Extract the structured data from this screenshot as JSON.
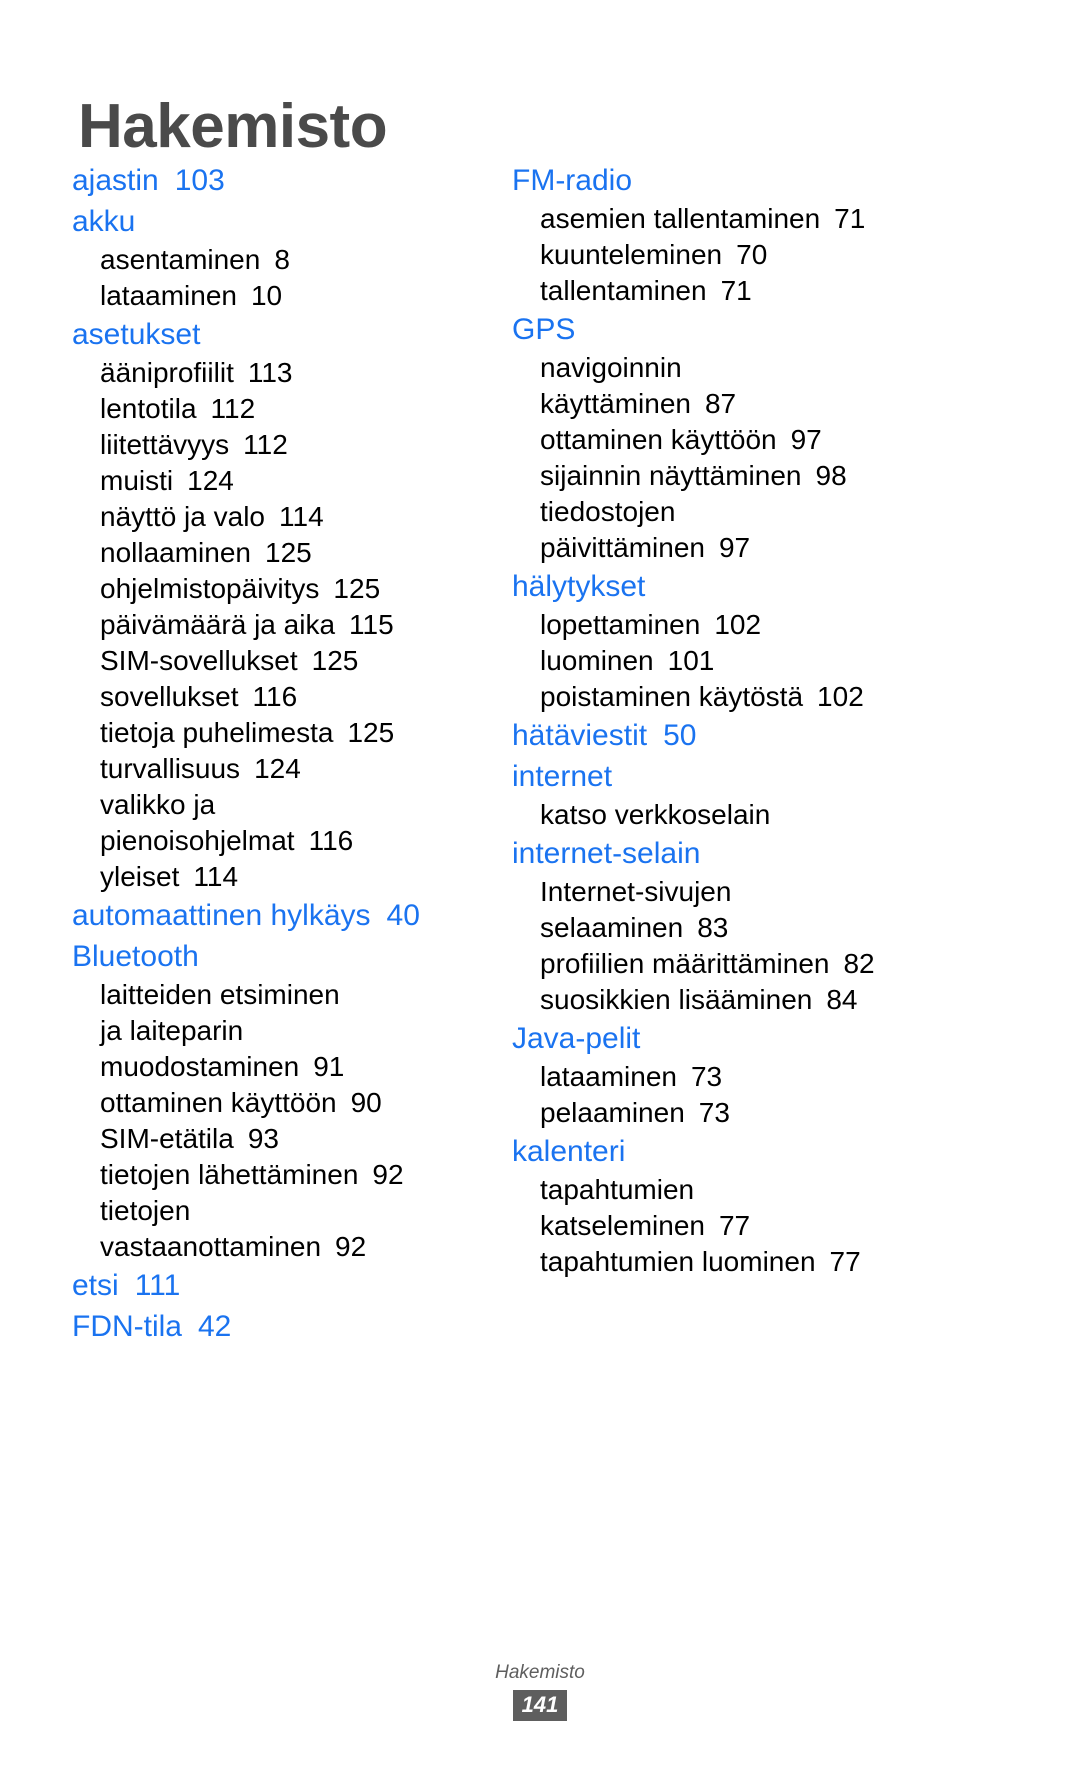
{
  "page": {
    "title": "Hakemisto",
    "footer_label": "Hakemisto",
    "footer_page": "141",
    "accent_color": "#1a73f0",
    "title_color": "#4a4a4a",
    "footer_color": "#5e5e5e"
  },
  "columns": [
    {
      "name": "left-column",
      "entries": [
        {
          "type": "term",
          "label": "ajastin",
          "page": "103"
        },
        {
          "type": "term",
          "label": "akku",
          "page": ""
        },
        {
          "type": "sub",
          "label": "asentaminen",
          "page": "8"
        },
        {
          "type": "sub",
          "label": "lataaminen",
          "page": "10"
        },
        {
          "type": "term",
          "label": "asetukset",
          "page": ""
        },
        {
          "type": "sub",
          "label": "ääniprofiilit",
          "page": "113"
        },
        {
          "type": "sub",
          "label": "lentotila",
          "page": "112"
        },
        {
          "type": "sub",
          "label": "liitettävyys",
          "page": "112"
        },
        {
          "type": "sub",
          "label": "muisti",
          "page": "124"
        },
        {
          "type": "sub",
          "label": "näyttö ja valo",
          "page": "114"
        },
        {
          "type": "sub",
          "label": "nollaaminen",
          "page": "125"
        },
        {
          "type": "sub",
          "label": "ohjelmistopäivitys",
          "page": "125"
        },
        {
          "type": "sub",
          "label": "päivämäärä ja aika",
          "page": "115"
        },
        {
          "type": "sub",
          "label": "SIM-sovellukset",
          "page": "125"
        },
        {
          "type": "sub",
          "label": "sovellukset",
          "page": "116"
        },
        {
          "type": "sub",
          "label": "tietoja puhelimesta",
          "page": "125"
        },
        {
          "type": "sub",
          "label": "turvallisuus",
          "page": "124"
        },
        {
          "type": "sub",
          "label": "valikko ja",
          "page": ""
        },
        {
          "type": "sub",
          "label": "pienoisohjelmat",
          "page": "116"
        },
        {
          "type": "sub",
          "label": "yleiset",
          "page": "114"
        },
        {
          "type": "term",
          "label": "automaattinen hylkäys",
          "page": "40"
        },
        {
          "type": "term",
          "label": "Bluetooth",
          "page": ""
        },
        {
          "type": "sub",
          "label": "laitteiden etsiminen",
          "page": ""
        },
        {
          "type": "sub",
          "label": "ja laiteparin",
          "page": ""
        },
        {
          "type": "sub",
          "label": "muodostaminen",
          "page": "91"
        },
        {
          "type": "sub",
          "label": "ottaminen käyttöön",
          "page": "90"
        },
        {
          "type": "sub",
          "label": "SIM-etätila",
          "page": "93"
        },
        {
          "type": "sub",
          "label": "tietojen lähettäminen",
          "page": "92"
        },
        {
          "type": "sub",
          "label": "tietojen",
          "page": ""
        },
        {
          "type": "sub",
          "label": "vastaanottaminen",
          "page": "92"
        },
        {
          "type": "term",
          "label": "etsi",
          "page": "111"
        },
        {
          "type": "term",
          "label": "FDN-tila",
          "page": "42"
        }
      ]
    },
    {
      "name": "right-column",
      "entries": [
        {
          "type": "term",
          "label": "FM-radio",
          "page": ""
        },
        {
          "type": "sub",
          "label": "asemien tallentaminen",
          "page": "71"
        },
        {
          "type": "sub",
          "label": "kuunteleminen",
          "page": "70"
        },
        {
          "type": "sub",
          "label": "tallentaminen",
          "page": "71"
        },
        {
          "type": "term",
          "label": "GPS",
          "page": ""
        },
        {
          "type": "sub",
          "label": "navigoinnin",
          "page": ""
        },
        {
          "type": "sub",
          "label": "käyttäminen",
          "page": "87"
        },
        {
          "type": "sub",
          "label": "ottaminen käyttöön",
          "page": "97"
        },
        {
          "type": "sub",
          "label": "sijainnin näyttäminen",
          "page": "98"
        },
        {
          "type": "sub",
          "label": "tiedostojen",
          "page": ""
        },
        {
          "type": "sub",
          "label": "päivittäminen",
          "page": "97"
        },
        {
          "type": "term",
          "label": "hälytykset",
          "page": ""
        },
        {
          "type": "sub",
          "label": "lopettaminen",
          "page": "102"
        },
        {
          "type": "sub",
          "label": "luominen",
          "page": "101"
        },
        {
          "type": "sub",
          "label": "poistaminen käytöstä",
          "page": "102"
        },
        {
          "type": "term",
          "label": "hätäviestit",
          "page": "50"
        },
        {
          "type": "term",
          "label": "internet",
          "page": ""
        },
        {
          "type": "sub",
          "label": "katso verkkoselain",
          "page": ""
        },
        {
          "type": "term",
          "label": "internet-selain",
          "page": ""
        },
        {
          "type": "sub",
          "label": "Internet-sivujen",
          "page": ""
        },
        {
          "type": "sub",
          "label": "selaaminen",
          "page": "83"
        },
        {
          "type": "sub",
          "label": "profiilien määrittäminen",
          "page": "82"
        },
        {
          "type": "sub",
          "label": "suosikkien lisääminen",
          "page": "84"
        },
        {
          "type": "term",
          "label": "Java-pelit",
          "page": ""
        },
        {
          "type": "sub",
          "label": "lataaminen",
          "page": "73"
        },
        {
          "type": "sub",
          "label": "pelaaminen",
          "page": "73"
        },
        {
          "type": "term",
          "label": "kalenteri",
          "page": ""
        },
        {
          "type": "sub",
          "label": "tapahtumien",
          "page": ""
        },
        {
          "type": "sub",
          "label": "katseleminen",
          "page": "77"
        },
        {
          "type": "sub",
          "label": "tapahtumien luominen",
          "page": "77"
        }
      ]
    }
  ]
}
